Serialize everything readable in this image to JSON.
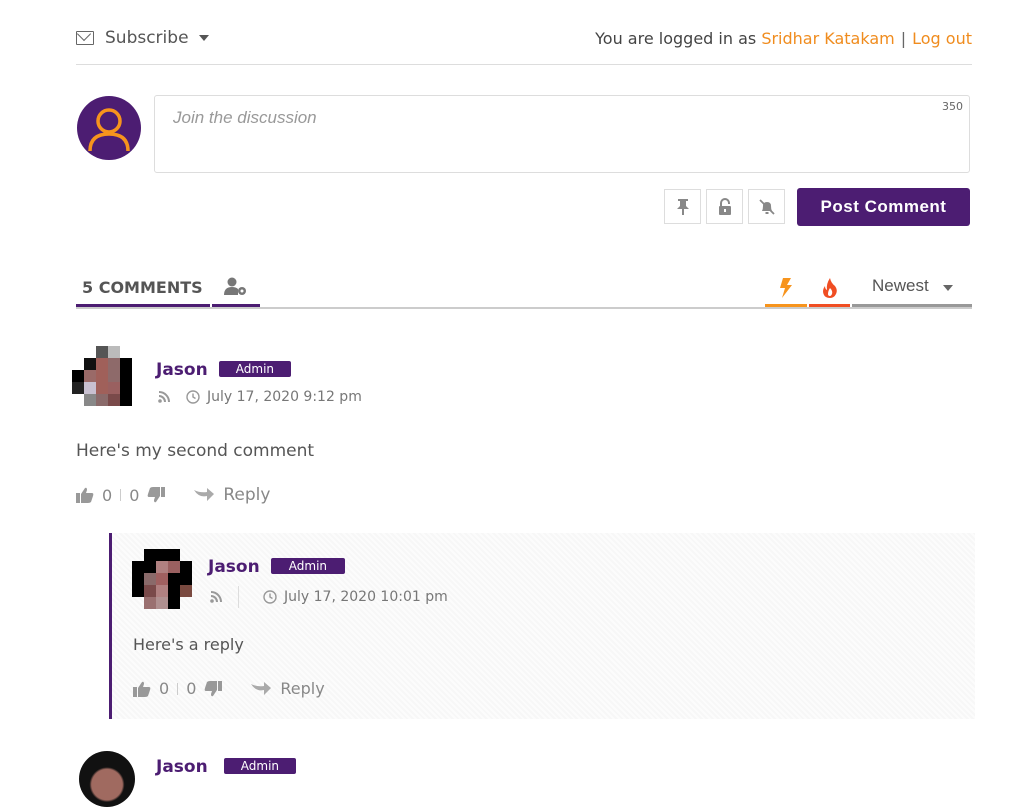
{
  "header": {
    "subscribe_label": "Subscribe",
    "login_prefix": "You are logged in as",
    "user_name": "Sridhar Katakam",
    "separator": "|",
    "logout_label": "Log out"
  },
  "composer": {
    "placeholder": "Join the discussion",
    "char_limit": "350",
    "tool_icons": [
      "pin-icon",
      "unlock-icon",
      "notification-off-icon"
    ],
    "post_button_label": "Post Comment"
  },
  "tabs": {
    "comments_label": "5 COMMENTS",
    "sort_label": "Newest",
    "colors": {
      "accent": "#4c1d72",
      "bolt": "#f7941d",
      "fire": "#f04e23"
    }
  },
  "comments": [
    {
      "author": "Jason",
      "badge": "Admin",
      "date": "July 17, 2020 9:12 pm",
      "text": "Here's my second comment",
      "likes": "0",
      "dislikes": "0",
      "reply_label": "Reply"
    },
    {
      "author": "Jason",
      "badge": "Admin",
      "date": "July 17, 2020 10:01 pm",
      "text": "Here's a reply",
      "likes": "0",
      "dislikes": "0",
      "reply_label": "Reply"
    },
    {
      "author": "Jason",
      "badge": "Admin"
    }
  ]
}
